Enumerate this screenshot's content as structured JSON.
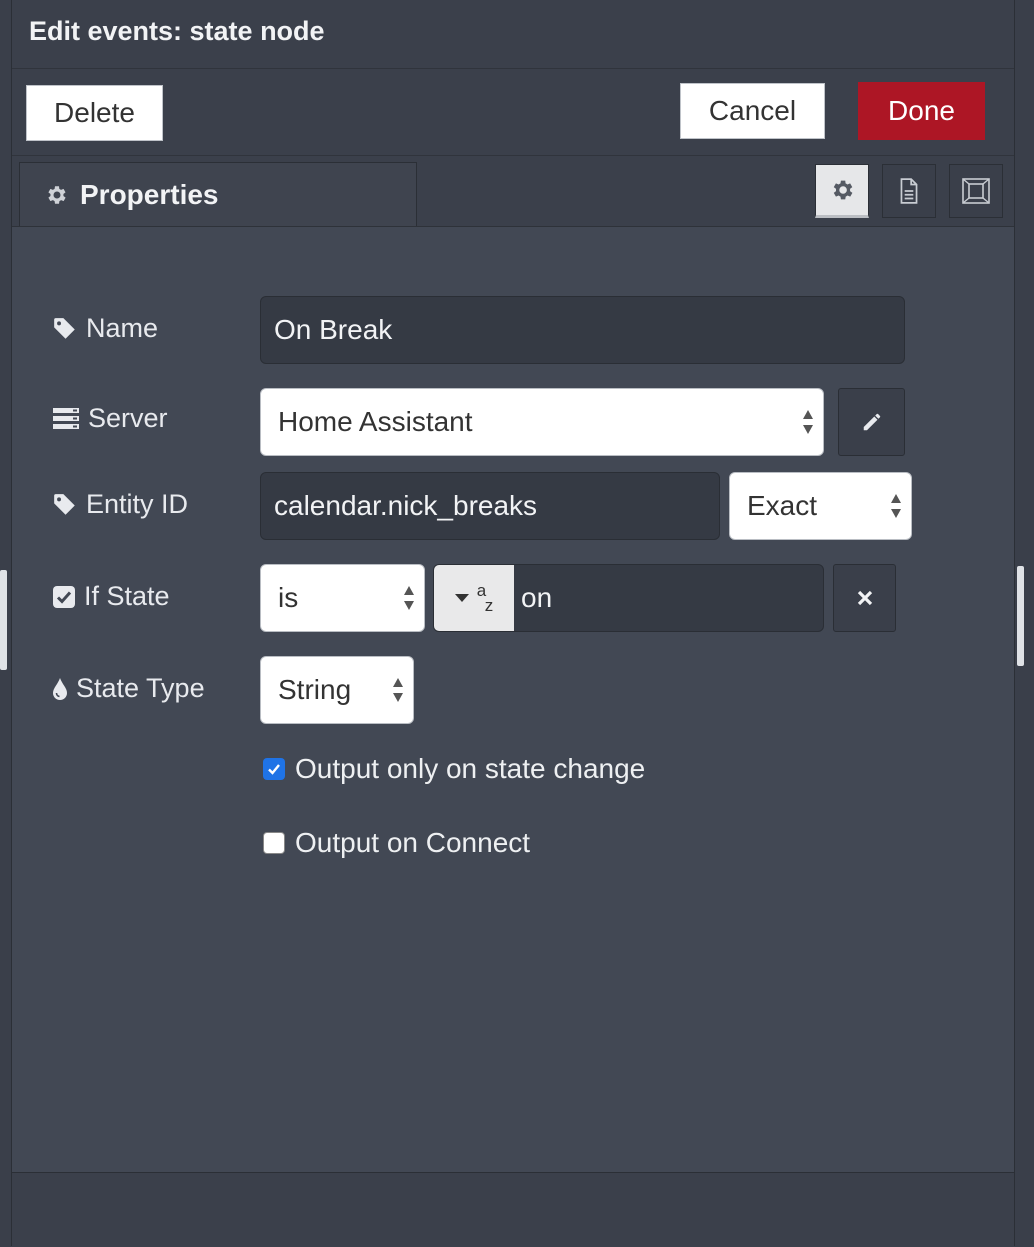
{
  "dialog": {
    "title": "Edit events: state node",
    "delete_label": "Delete",
    "cancel_label": "Cancel",
    "done_label": "Done",
    "done_color": "#ad1625"
  },
  "tabs": {
    "properties_label": "Properties",
    "icons": [
      "gear-icon",
      "description-icon",
      "appearance-icon"
    ],
    "active": "gear-icon"
  },
  "form": {
    "name": {
      "label": "Name",
      "value": "On Break"
    },
    "server": {
      "label": "Server",
      "value": "Home Assistant"
    },
    "entity_id": {
      "label": "Entity ID",
      "value": "calendar.nick_breaks",
      "match": "Exact"
    },
    "if_state": {
      "label": "If State",
      "operator": "is",
      "value": "on",
      "type_glyph_top": "a",
      "type_glyph_bottom": "z"
    },
    "state_type": {
      "label": "State Type",
      "value": "String"
    },
    "output_only_on_state_change": {
      "label": "Output only on state change",
      "checked": true
    },
    "output_on_connect": {
      "label": "Output on Connect",
      "checked": false
    }
  }
}
